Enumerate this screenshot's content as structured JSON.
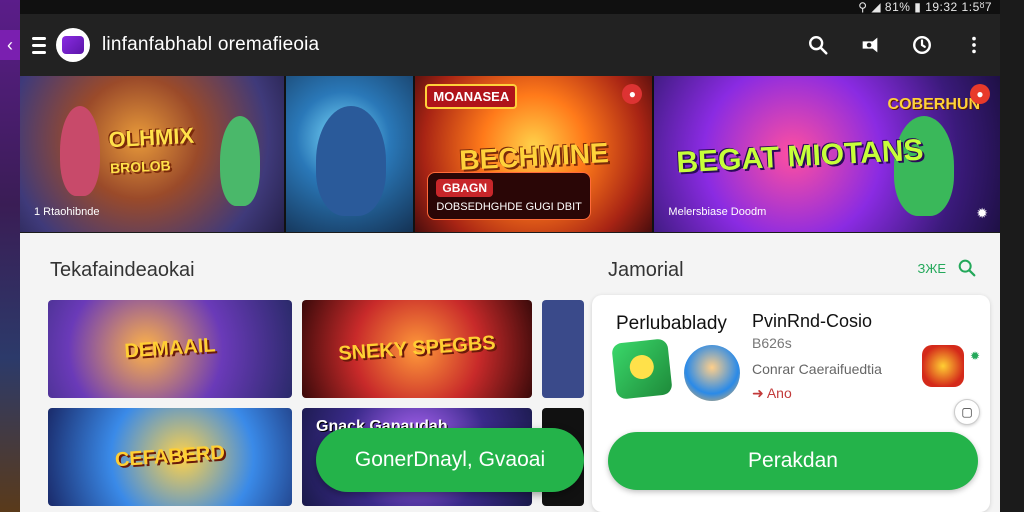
{
  "status_bar": {
    "text": "⚲ ◢ 81% ▮ 19:32 1:5ᴽ7"
  },
  "app_bar": {
    "title": "linfanfabhabl oremafieoia",
    "icons": [
      "menu-icon",
      "app-logo",
      "search-icon",
      "share-icon",
      "history-icon",
      "more-vert-icon"
    ]
  },
  "banners": [
    {
      "title": "OLHMIX",
      "subtitle": "BROLOB",
      "caption": "1 Rtaohibnde"
    },
    {
      "title": ""
    },
    {
      "tag": "MOANASEA",
      "title": "BECHMINE",
      "pill_title": "GBAGN",
      "pill_text": "DOBSEDHGHDE GUGI DBIT"
    },
    {
      "tag2": "COBERHUN",
      "title": "BEGAT MIOTANS",
      "caption": "Melersbiase Doodm"
    }
  ],
  "left_section": {
    "title": "Tekafaindeaokai",
    "thumbs": [
      {
        "label": "DEMAAIL"
      },
      {
        "label": "SNEKY SPEGBS"
      },
      {
        "label": ""
      },
      {
        "label": "CEFABERD"
      },
      {
        "label": "Gnack Gapaudah"
      },
      {
        "label": ""
      }
    ],
    "cta": "GonerDnayl, Gvaoai"
  },
  "right_section": {
    "title": "Jamorial",
    "see_all": "ЗЖЕ",
    "card": {
      "title_left": "Perlubablady",
      "title_right": "PvinRnd-Cosio",
      "subtitle": "B626s",
      "description": "Conrar Caeraifuedtia",
      "meta": "➜ Ano",
      "install": "Perakdan"
    }
  },
  "colors": {
    "accent_green": "#24b34a",
    "appbar_bg": "#222222",
    "panel_bg": "#f4f4f4"
  }
}
